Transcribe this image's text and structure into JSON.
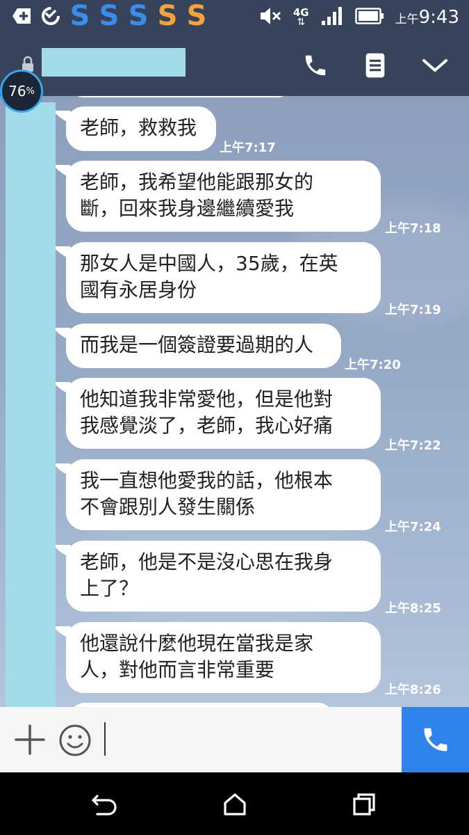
{
  "status_bar": {
    "time_prefix": "上午",
    "time": "9:43",
    "network": "4G",
    "notification_icons": [
      "add-box-icon",
      "sync-icon",
      "s-app-icon",
      "s-app-icon",
      "s-app-icon",
      "s-app-icon",
      "s-app-icon"
    ],
    "notification_colors": [
      "#3a8dea",
      "#3a8dea",
      "#3a8dea",
      "#f2a33a",
      "#f2a33a"
    ]
  },
  "header": {
    "contact_name": "",
    "icons": [
      "lock-icon",
      "phone-icon",
      "menu-icon",
      "chevron-down-icon"
    ]
  },
  "battery_badge": {
    "value": "76",
    "unit": "%"
  },
  "messages": [
    {
      "text": "老師，救救我",
      "time": "上午7:17"
    },
    {
      "text": "老師，我希望他能跟那女的\n斷，回來我身邊繼續愛我",
      "time": "上午7:18"
    },
    {
      "text": "那女人是中國人，35歲，在英\n國有永居身份",
      "time": "上午7:19"
    },
    {
      "text": "而我是一個簽證要過期的人",
      "time": "上午7:20"
    },
    {
      "text": "他知道我非常愛他，但是他對\n我感覺淡了，老師，我心好痛",
      "time": "上午7:22"
    },
    {
      "text": "我一直想他愛我的話，他根本\n不會跟別人發生關係",
      "time": "上午7:24"
    },
    {
      "text": "老師，他是不是沒心思在我身\n上了？",
      "time": "上午8:25"
    },
    {
      "text": "他還說什麼他現在當我是家\n人，對他而言非常重要",
      "time": "上午8:26"
    }
  ],
  "input_bar": {
    "message_value": "",
    "icons": [
      "plus-icon",
      "emoji-icon",
      "call-icon"
    ],
    "accent": "#2f83ea"
  },
  "nav_bar": {
    "icons": [
      "back-icon",
      "home-icon",
      "recents-icon"
    ]
  }
}
